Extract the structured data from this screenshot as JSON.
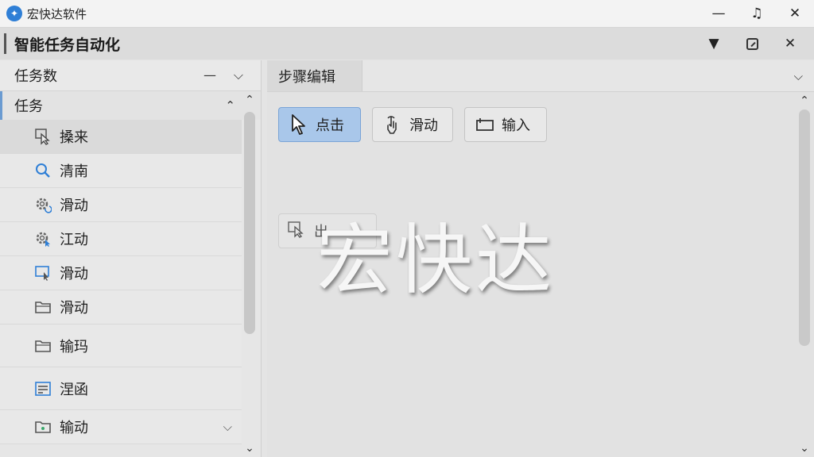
{
  "window": {
    "title": "宏快达软件",
    "icon": "app-logo-icon",
    "controls": [
      "minimize-icon",
      "restore-icon",
      "close-icon"
    ]
  },
  "document": {
    "title": "智能任务自动化",
    "controls": [
      "dropdown-icon",
      "popout-icon",
      "close-icon"
    ]
  },
  "left_panel": {
    "header": "任务数",
    "group": {
      "title": "任务",
      "expanded": true
    },
    "items": [
      {
        "label": "搡来",
        "icon": "cursor-select-icon"
      },
      {
        "label": "清南",
        "icon": "search-icon"
      },
      {
        "label": "滑动",
        "icon": "gear-refresh-icon"
      },
      {
        "label": "江动",
        "icon": "gear-cursor-icon"
      },
      {
        "label": "滑动",
        "icon": "screen-cursor-icon"
      },
      {
        "label": "滑动",
        "icon": "folder-icon"
      },
      {
        "label": "输玛",
        "icon": "folder-icon"
      },
      {
        "label": "涅函",
        "icon": "form-icon"
      },
      {
        "label": "输动",
        "icon": "folder-dot-icon"
      }
    ]
  },
  "right_panel": {
    "tab": "步骤编辑",
    "actions": [
      {
        "label": "点击",
        "icon": "pointer-icon",
        "active": true
      },
      {
        "label": "滑动",
        "icon": "touch-hand-icon",
        "active": false
      },
      {
        "label": "输入",
        "icon": "input-box-icon",
        "active": false
      }
    ],
    "ghost_label": "出",
    "watermark": "宏快达"
  },
  "colors": {
    "accent": "#6b9bd1",
    "active_button": "#a9c7ea",
    "app_icon": "#2f7fd6"
  }
}
